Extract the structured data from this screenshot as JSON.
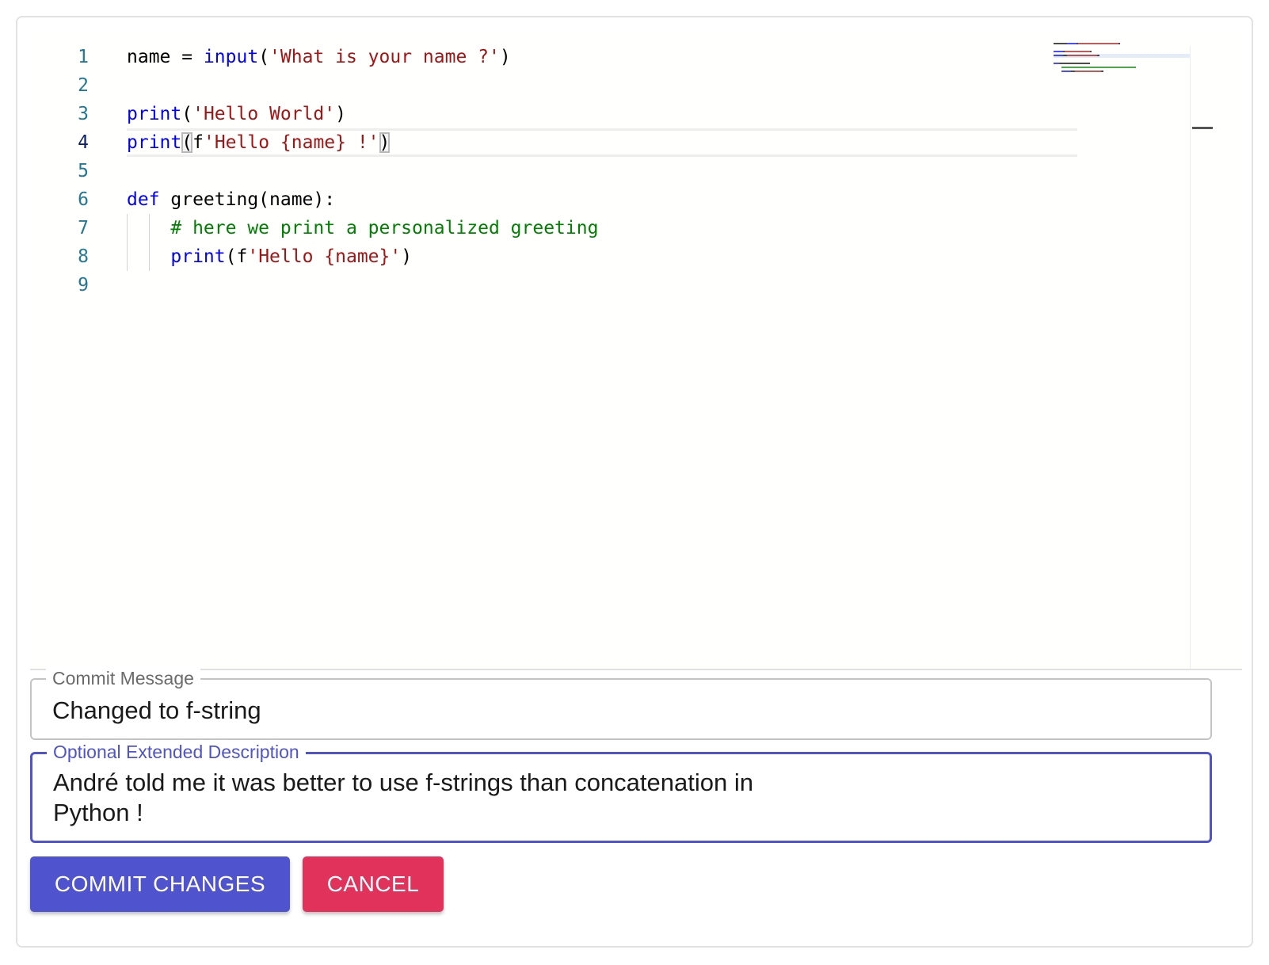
{
  "editor": {
    "language": "python",
    "active_line": 4,
    "line_numbers": [
      "1",
      "2",
      "3",
      "4",
      "5",
      "6",
      "7",
      "8",
      "9"
    ],
    "lines": [
      {
        "tokens": [
          {
            "t": "name = ",
            "c": "plain"
          },
          {
            "t": "input",
            "c": "fn"
          },
          {
            "t": "(",
            "c": "plain"
          },
          {
            "t": "'What is your name ?'",
            "c": "str"
          },
          {
            "t": ")",
            "c": "plain"
          }
        ]
      },
      {
        "tokens": []
      },
      {
        "tokens": [
          {
            "t": "print",
            "c": "fn"
          },
          {
            "t": "(",
            "c": "plain"
          },
          {
            "t": "'Hello World'",
            "c": "str"
          },
          {
            "t": ")",
            "c": "plain"
          }
        ]
      },
      {
        "tokens": [
          {
            "t": "print",
            "c": "fn"
          },
          {
            "t": "(",
            "c": "bracket"
          },
          {
            "t": "f",
            "c": "plain"
          },
          {
            "t": "'Hello {name} !'",
            "c": "str"
          },
          {
            "t": ")",
            "c": "bracket"
          }
        ]
      },
      {
        "tokens": []
      },
      {
        "tokens": [
          {
            "t": "def",
            "c": "kw"
          },
          {
            "t": " greeting(name):",
            "c": "plain"
          }
        ]
      },
      {
        "indent": 1,
        "tokens": [
          {
            "t": "# here we print a personalized greeting",
            "c": "cmt"
          }
        ]
      },
      {
        "indent": 1,
        "tokens": [
          {
            "t": "print",
            "c": "fn"
          },
          {
            "t": "(f",
            "c": "plain"
          },
          {
            "t": "'Hello {name}'",
            "c": "str"
          },
          {
            "t": ")",
            "c": "plain"
          }
        ]
      },
      {
        "tokens": []
      }
    ]
  },
  "commit_field": {
    "label": "Commit Message",
    "value": "Changed to f-string"
  },
  "description_field": {
    "label": "Optional Extended Description",
    "value": "André told me it was better to use f-strings than concatenation in Python !"
  },
  "buttons": {
    "commit_label": "COMMIT CHANGES",
    "cancel_label": "CANCEL"
  },
  "colors": {
    "primary": "#4f53cd",
    "danger": "#e0325a",
    "keyword": "#0000ff",
    "string": "#a31515",
    "comment": "#008000",
    "line_number": "#237893"
  }
}
